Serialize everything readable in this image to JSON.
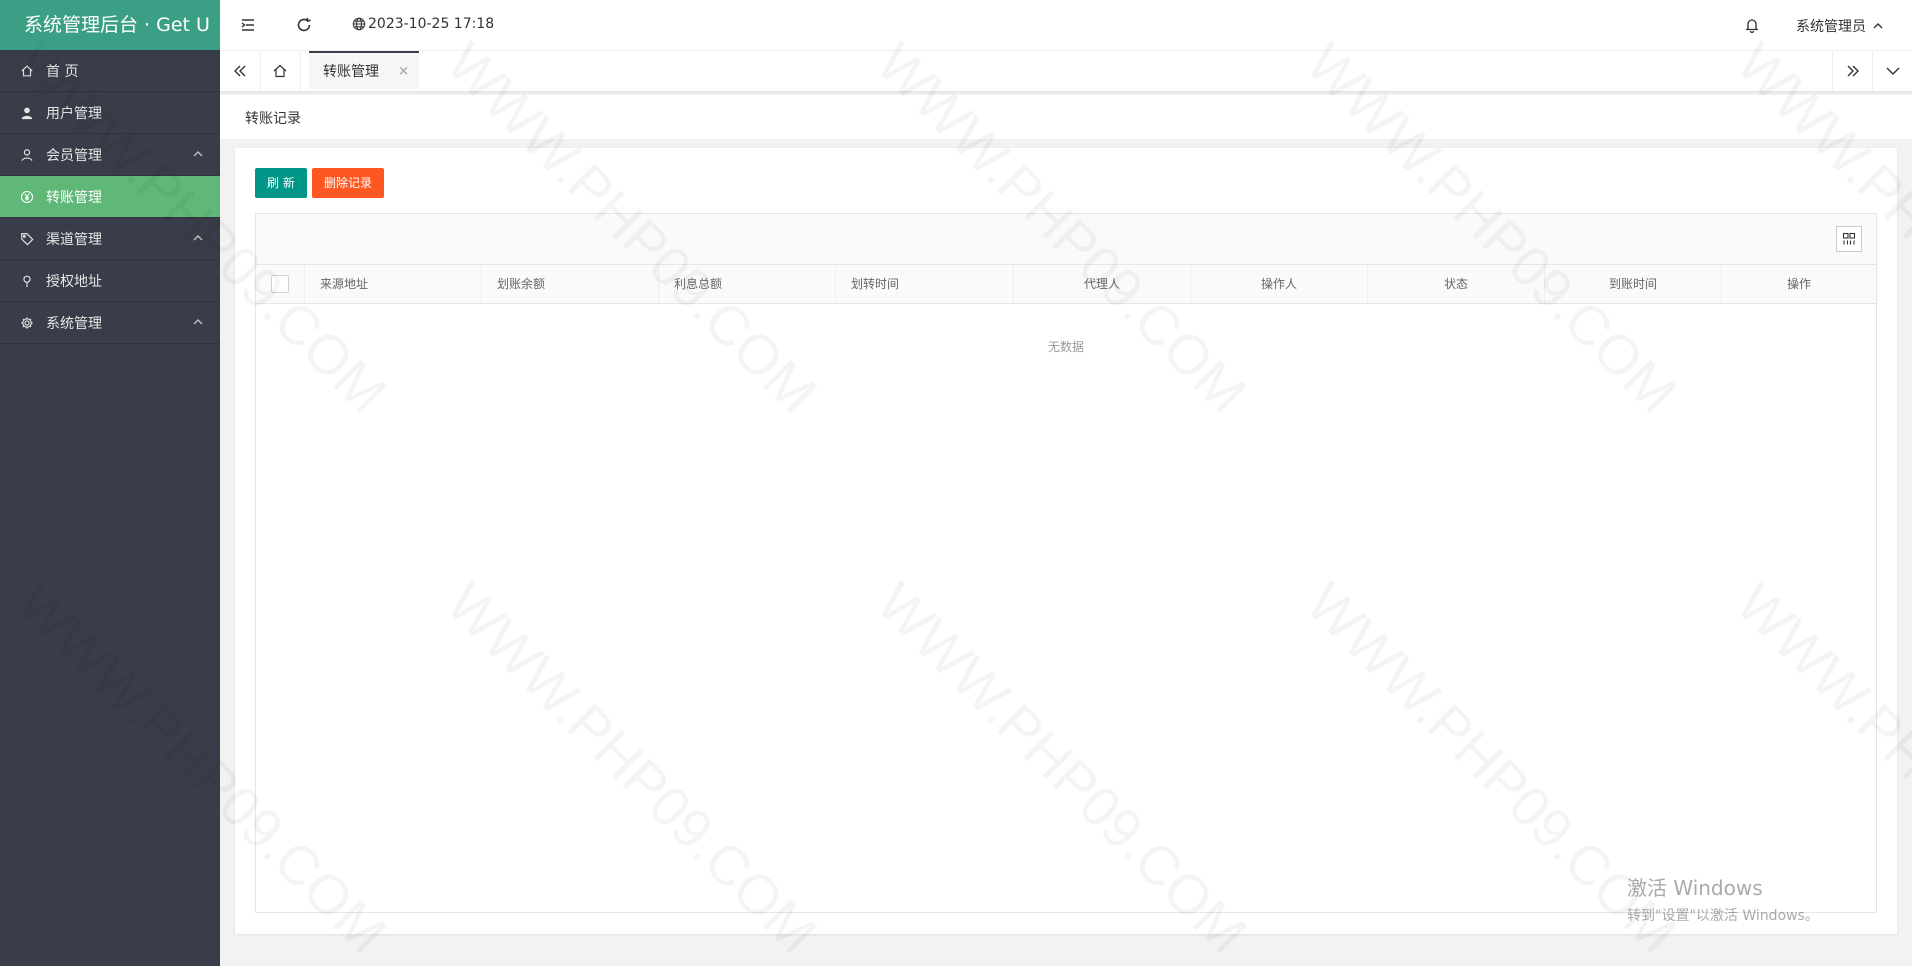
{
  "app": {
    "title": "系统管理后台 · Get U"
  },
  "sidebar": {
    "items": [
      {
        "label": "首 页",
        "icon": "home-icon",
        "active": false,
        "expandable": false
      },
      {
        "label": "用户管理",
        "icon": "user-icon",
        "active": false,
        "expandable": false
      },
      {
        "label": "会员管理",
        "icon": "member-icon",
        "active": false,
        "expandable": true
      },
      {
        "label": "转账管理",
        "icon": "yen-circle-icon",
        "active": true,
        "expandable": false
      },
      {
        "label": "渠道管理",
        "icon": "tag-icon",
        "active": false,
        "expandable": true
      },
      {
        "label": "授权地址",
        "icon": "location-pin-icon",
        "active": false,
        "expandable": false
      },
      {
        "label": "系统管理",
        "icon": "gear-icon",
        "active": false,
        "expandable": true
      }
    ]
  },
  "header": {
    "datetime": "2023-10-25 17:18",
    "user_name": "系统管理员"
  },
  "tabs": {
    "items": [
      {
        "label": "转账管理",
        "active": true,
        "close": "×"
      }
    ]
  },
  "breadcrumb": {
    "label": "转账记录"
  },
  "toolbar": {
    "refresh_label": "刷 新",
    "delete_label": "删除记录"
  },
  "table": {
    "columns": [
      "来源地址",
      "划账余额",
      "利息总额",
      "划转时间",
      "代理人",
      "操作人",
      "状态",
      "到账时间",
      "操作"
    ],
    "rows": [],
    "empty_text": "无数据"
  },
  "watermark": "WWW.PHP09.COM",
  "os_notice": {
    "title": "激活 Windows",
    "subtitle": "转到\"设置\"以激活 Windows。"
  },
  "colors": {
    "logo_bg": "#3b9f86",
    "sidebar_bg": "#393d49",
    "active_item": "#5fb878",
    "refresh_button": "#009688",
    "delete_button": "#ff5722"
  }
}
